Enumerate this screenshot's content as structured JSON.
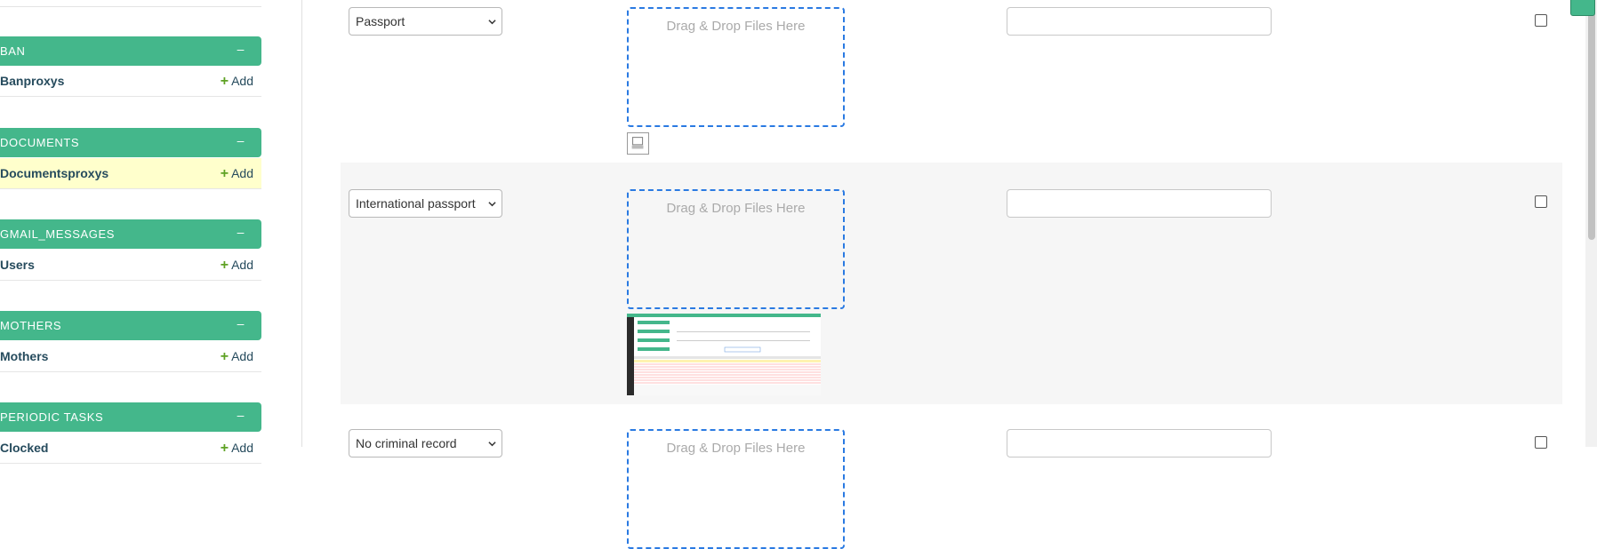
{
  "sidebar": {
    "modules": [
      {
        "caption": "BAN",
        "toggle": "–",
        "models": [
          {
            "name": "Banproxys",
            "add": "Add"
          }
        ]
      },
      {
        "caption": "DOCUMENTS",
        "toggle": "–",
        "models": [
          {
            "name": "Documentsproxys",
            "add": "Add"
          }
        ]
      },
      {
        "caption": "GMAIL_MESSAGES",
        "toggle": "–",
        "models": [
          {
            "name": "Users",
            "add": "Add"
          }
        ]
      },
      {
        "caption": "MOTHERS",
        "toggle": "–",
        "models": [
          {
            "name": "Mothers",
            "add": "Add"
          }
        ]
      },
      {
        "caption": "PERIODIC TASKS",
        "toggle": "–",
        "models": [
          {
            "name": "Clocked",
            "add": "Add"
          }
        ]
      }
    ],
    "add_icon": "plus-icon"
  },
  "rows": [
    {
      "doc_type": "Passport",
      "dropzone_text": "Drag & Drop Files Here",
      "has_file_icon": true
    },
    {
      "doc_type": "International passport",
      "dropzone_text": "Drag & Drop Files Here",
      "has_thumbnail": true
    },
    {
      "doc_type": "No criminal record",
      "dropzone_text": "Drag & Drop Files Here"
    }
  ],
  "colors": {
    "module_header": "#44b78b",
    "selected_row": "#ffffcc",
    "dropzone_border": "#2a7ae2",
    "add_plus": "#5fa225",
    "link": "#264b5d"
  }
}
